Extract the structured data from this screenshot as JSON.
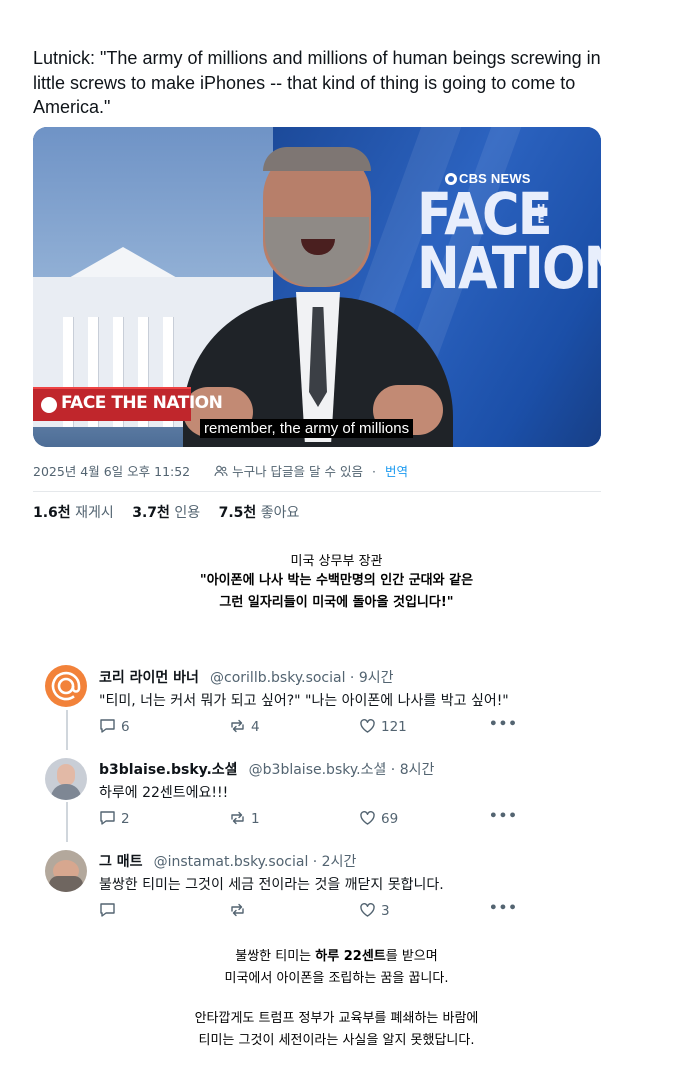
{
  "tweet": {
    "text": "Lutnick: \"The army of millions and millions of human beings screwing in little screws to make iPhones -- that kind of thing is going to come to America.\"",
    "media": {
      "cbs_news_logo": "CBS NEWS",
      "show_title_line1": "FACE",
      "show_title_line2": "NATION",
      "show_title_the": "THE",
      "lower_third": "FACE THE NATION",
      "caption": "remember, the army of millions"
    },
    "timestamp": "2025년 4월 6일 오후 11:52",
    "reply_setting": "누구나 답글을 달 수 있음",
    "translate_label": "번역",
    "stats": [
      {
        "count": "1.6천",
        "label": "재게시"
      },
      {
        "count": "3.7천",
        "label": "인용"
      },
      {
        "count": "7.5천",
        "label": "좋아요"
      }
    ]
  },
  "caption_block": {
    "title": "미국 상무부 장관",
    "quote_line1": "\"아이폰에 나사 박는 수백만명의 인간 군대와 같은",
    "quote_line2": "그런 일자리들이 미국에 돌아올 것입니다!\""
  },
  "posts": [
    {
      "name": "코리 라이먼 바너",
      "handle": "@corillb.bsky.social · 9시간",
      "body": "\"티미, 너는 커서 뭐가 되고 싶어?\" \"나는 아이폰에 나사를 박고 싶어!\"",
      "replies": "6",
      "reposts": "4",
      "likes": "121",
      "avatar_color": "#f2823a"
    },
    {
      "name": "b3blaise.bsky.소셜",
      "handle": "@b3blaise.bsky.소셜 · 8시간",
      "body": "하루에 22센트에요!!!",
      "replies": "2",
      "reposts": "1",
      "likes": "69",
      "avatar_color": "#c9ced6"
    },
    {
      "name": "그 매트",
      "handle": "@instamat.bsky.social · 2시간",
      "body": "불쌍한 티미는 그것이 세금 전이라는 것을 깨닫지 못합니다.",
      "replies": "",
      "reposts": "",
      "likes": "3",
      "avatar_color": "#9a8a7c"
    }
  ],
  "bottom": {
    "line1_pre": "불쌍한 티미는 ",
    "line1_bold": "하루 22센트",
    "line1_post": "를 받으며",
    "line2": "미국에서 아이폰을 조립하는 꿈을 꿉니다.",
    "line3": "안타깝게도 트럼프 정부가 교육부를 폐쇄하는 바람에",
    "line4": "티미는 그것이 세전이라는 사실을 알지 못했답니다."
  }
}
